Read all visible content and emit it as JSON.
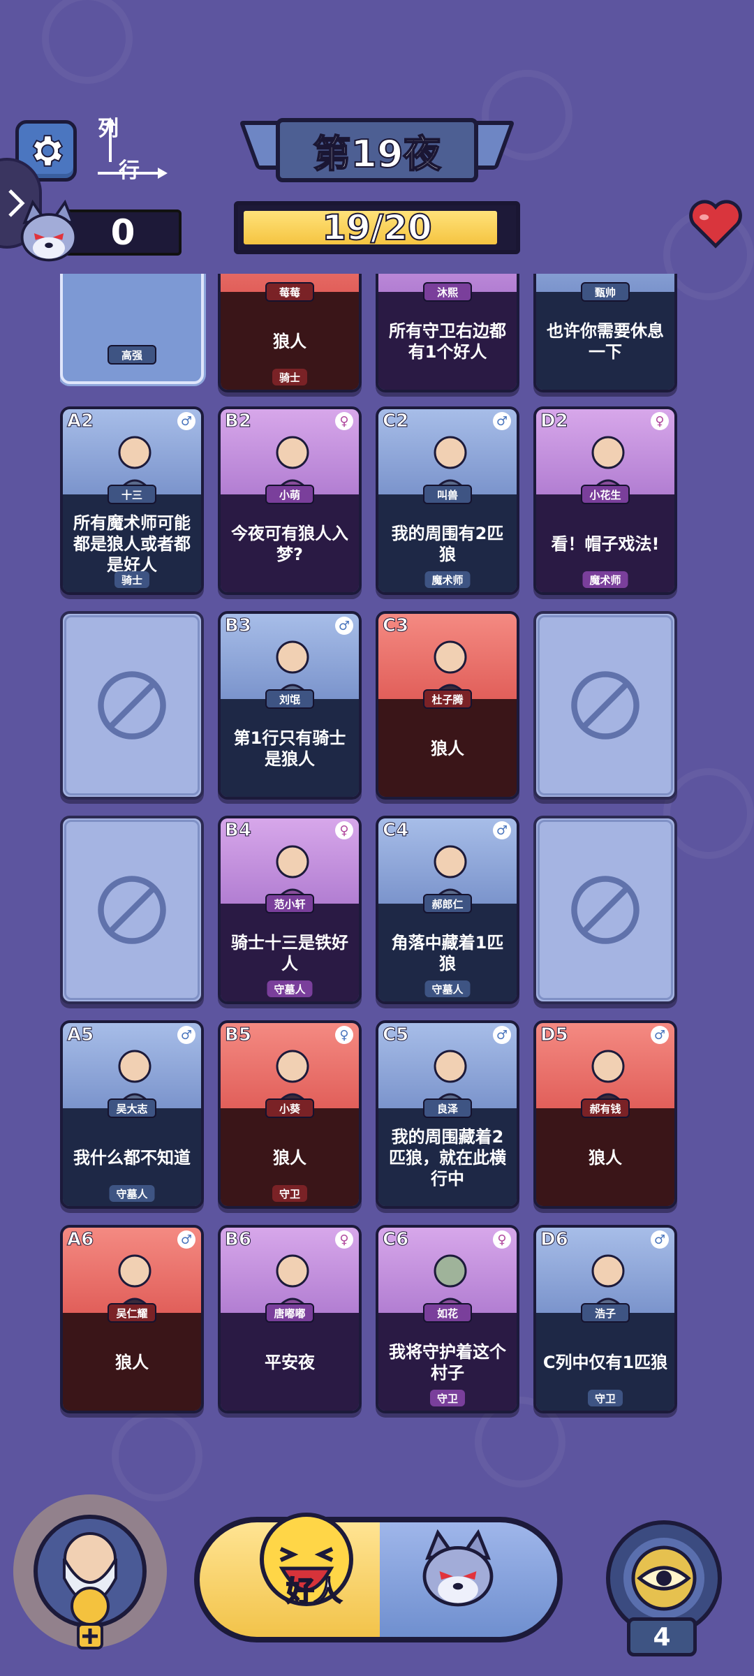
{
  "header": {
    "axis_col": "列",
    "axis_row": "行",
    "wolf_count": "0",
    "night_title": "第19夜",
    "progress_text": "19/20",
    "progress_value": 0.95
  },
  "board": {
    "row0": [
      {
        "name": "高强",
        "state": "selected"
      },
      {
        "name": "莓莓",
        "clue": "狼人",
        "role": "骑士",
        "theme": "red"
      },
      {
        "name": "沐熙",
        "clue": "所有守卫右边都有1个好人",
        "theme": "purple"
      },
      {
        "name": "甄帅",
        "clue": "也许你需要休息一下",
        "theme": "blue"
      }
    ],
    "row2": [
      {
        "pos": "A2",
        "gender": "male",
        "name": "十三",
        "clue": "所有魔术师可能都是狼人或者都是好人",
        "role": "骑士",
        "theme": "blue"
      },
      {
        "pos": "B2",
        "gender": "female",
        "name": "小萌",
        "clue": "今夜可有狼人入梦?",
        "theme": "purple"
      },
      {
        "pos": "C2",
        "gender": "male",
        "name": "叫兽",
        "clue": "我的周围有2匹狼",
        "role": "魔术师",
        "theme": "blue"
      },
      {
        "pos": "D2",
        "gender": "female",
        "name": "小花生",
        "clue": "看！帽子戏法!",
        "role": "魔术师",
        "theme": "purple"
      }
    ],
    "row3": [
      {
        "state": "empty"
      },
      {
        "pos": "B3",
        "gender": "male",
        "name": "刘氓",
        "clue": "第1行只有骑士是狼人",
        "theme": "blue"
      },
      {
        "pos": "C3",
        "gender": "male",
        "name": "杜子腾",
        "clue": "狼人",
        "theme": "red"
      },
      {
        "state": "empty"
      }
    ],
    "row4": [
      {
        "state": "empty"
      },
      {
        "pos": "B4",
        "gender": "female",
        "name": "范小轩",
        "clue": "骑士十三是铁好人",
        "role": "守墓人",
        "theme": "purple"
      },
      {
        "pos": "C4",
        "gender": "male",
        "name": "郝郎仁",
        "clue": "角落中藏着1匹狼",
        "role": "守墓人",
        "theme": "blue"
      },
      {
        "state": "empty"
      }
    ],
    "row5": [
      {
        "pos": "A5",
        "gender": "male",
        "name": "吴大志",
        "clue": "我什么都不知道",
        "role": "守墓人",
        "theme": "blue"
      },
      {
        "pos": "B5",
        "gender": "female",
        "name": "小葵",
        "clue": "狼人",
        "role": "守卫",
        "theme": "red"
      },
      {
        "pos": "C5",
        "gender": "male",
        "name": "良泽",
        "clue": "我的周围藏着2匹狼，就在此横行中",
        "theme": "blue"
      },
      {
        "pos": "D5",
        "gender": "male",
        "name": "郝有钱",
        "clue": "狼人",
        "theme": "red"
      }
    ],
    "row6": [
      {
        "pos": "A6",
        "gender": "male",
        "name": "吴仁耀",
        "clue": "狼人",
        "theme": "red"
      },
      {
        "pos": "B6",
        "gender": "female",
        "name": "唐嘟嘟",
        "clue": "平安夜",
        "theme": "purple"
      },
      {
        "pos": "C6",
        "gender": "female",
        "name": "如花",
        "clue": "我将守护着这个村子",
        "role": "守卫",
        "theme": "purple"
      },
      {
        "pos": "D6",
        "gender": "male",
        "name": "浩子",
        "clue": "C列中仅有1匹狼",
        "role": "守卫",
        "theme": "blue"
      }
    ]
  },
  "footer": {
    "mode_label": "好人",
    "hint_count": "4"
  },
  "colors": {
    "background": "#5d559f",
    "good": "#f2c34a",
    "wolf": "#e15f5a",
    "villager_blue": "#7b94cc",
    "mage_purple": "#b27ed2"
  },
  "icons": {
    "settings": "gear-icon",
    "wolf_counter": "wolf-icon",
    "lives": "heart-icon",
    "empty_slot": "ban-icon",
    "hint": "eye-icon",
    "wizard": "wizard-icon"
  }
}
